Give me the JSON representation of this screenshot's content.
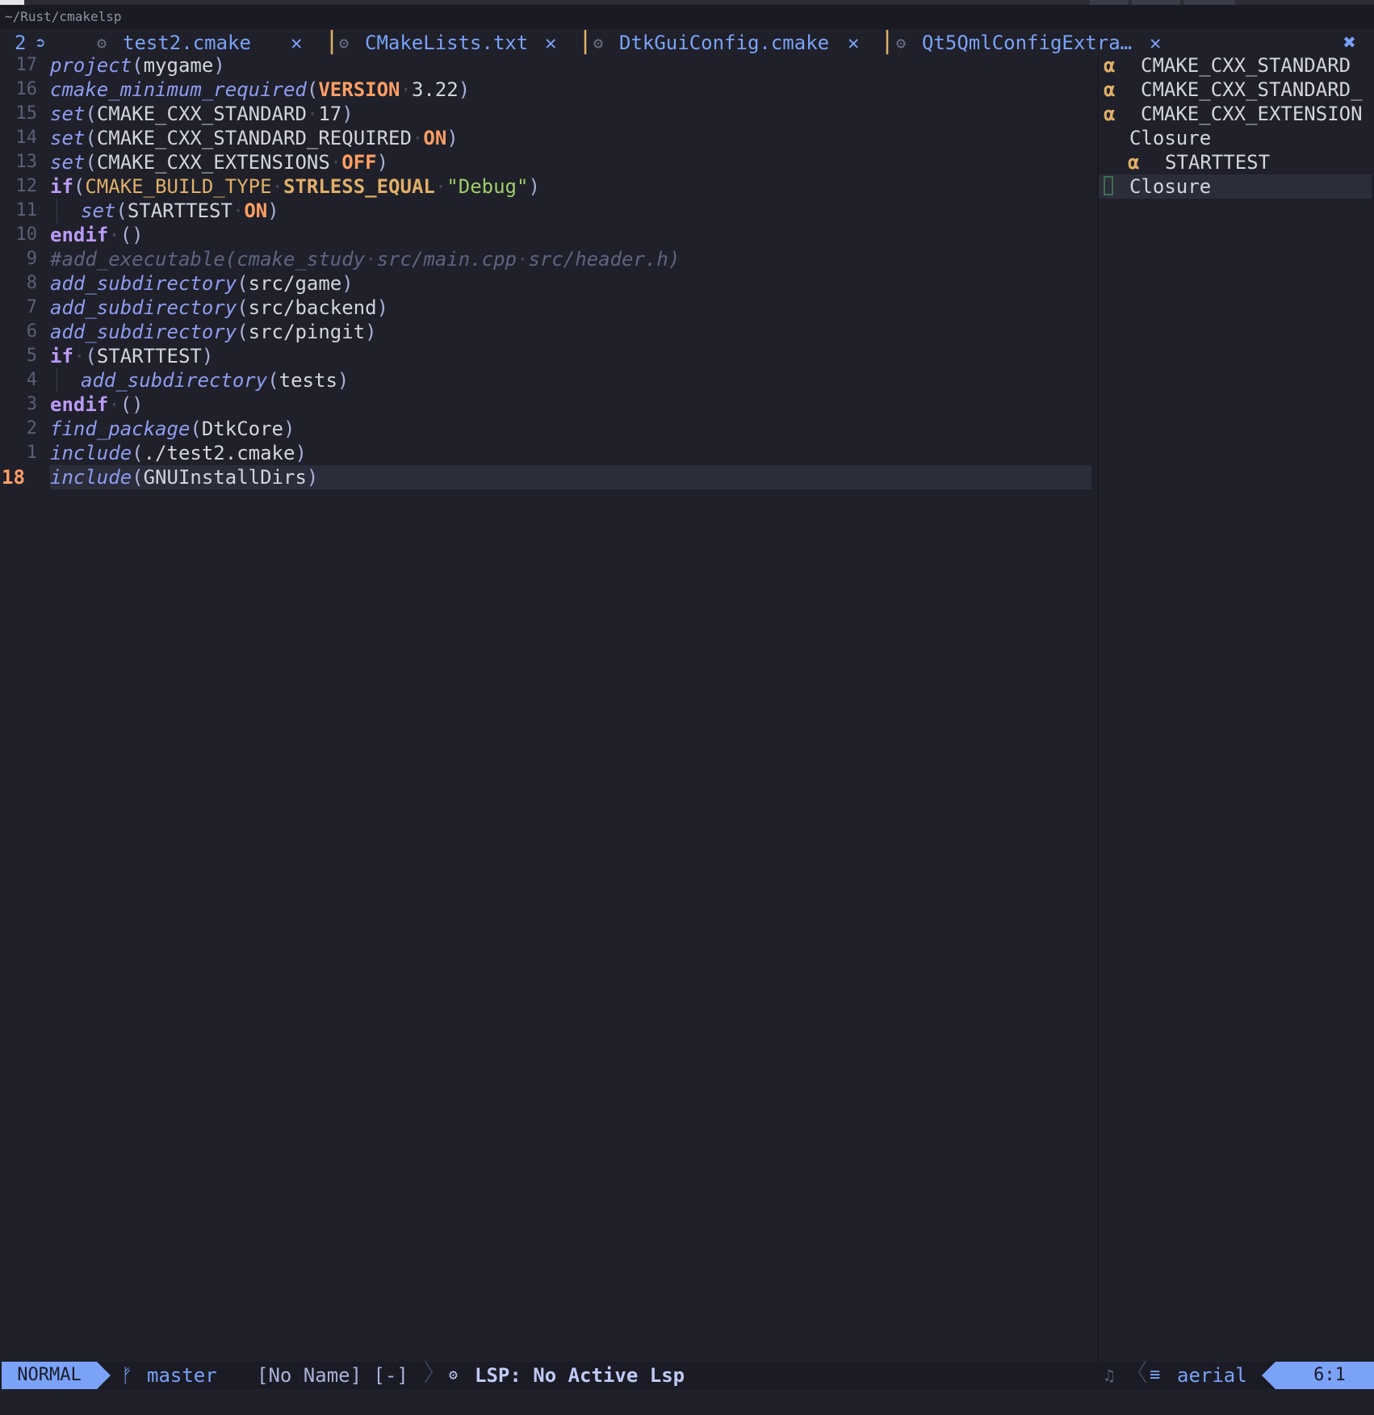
{
  "path": "~/Rust/cmakelsp",
  "tabline": {
    "buffer_count": "2",
    "back_icon": "back-arrow-icon",
    "tabs": [
      {
        "title": "test2.cmake",
        "icon": "gear-icon"
      },
      {
        "title": "CMakeLists.txt",
        "icon": "gear-icon"
      },
      {
        "title": "DtkGuiConfig.cmake",
        "icon": "gear-icon"
      },
      {
        "title": "Qt5QmlConfigExtra…",
        "icon": "gear-icon"
      }
    ]
  },
  "editor": {
    "lines": [
      {
        "num": "17",
        "tokens": [
          [
            "fn",
            "project"
          ],
          [
            "pn",
            "("
          ],
          [
            "tx",
            "mygame"
          ],
          [
            "pn",
            ")"
          ]
        ]
      },
      {
        "num": "16",
        "tokens": [
          [
            "fn",
            "cmake_minimum_required"
          ],
          [
            "pn",
            "("
          ],
          [
            "or",
            "VERSION"
          ],
          [
            "dot",
            "·"
          ],
          [
            "tx",
            "3.22"
          ],
          [
            "pn",
            ")"
          ]
        ]
      },
      {
        "num": "15",
        "tokens": [
          [
            "fn",
            "set"
          ],
          [
            "pn",
            "("
          ],
          [
            "tx",
            "CMAKE_CXX_STANDARD"
          ],
          [
            "dot",
            "·"
          ],
          [
            "tx",
            "17"
          ],
          [
            "pn",
            ")"
          ]
        ]
      },
      {
        "num": "14",
        "tokens": [
          [
            "fn",
            "set"
          ],
          [
            "pn",
            "("
          ],
          [
            "tx",
            "CMAKE_CXX_STANDARD_REQUIRED"
          ],
          [
            "dot",
            "·"
          ],
          [
            "or",
            "ON"
          ],
          [
            "pn",
            ")"
          ]
        ]
      },
      {
        "num": "13",
        "tokens": [
          [
            "fn",
            "set"
          ],
          [
            "pn",
            "("
          ],
          [
            "tx",
            "CMAKE_CXX_EXTENSIONS"
          ],
          [
            "dot",
            "·"
          ],
          [
            "or",
            "OFF"
          ],
          [
            "pn",
            ")"
          ]
        ]
      },
      {
        "num": "12",
        "tokens": [
          [
            "kw",
            "if"
          ],
          [
            "pn",
            "("
          ],
          [
            "yn",
            "CMAKE_BUILD_TYPE"
          ],
          [
            "dot",
            "·"
          ],
          [
            "yl",
            "STRLESS_EQUAL"
          ],
          [
            "dot",
            "·"
          ],
          [
            "str",
            "\"Debug\""
          ],
          [
            "pn",
            ")"
          ]
        ]
      },
      {
        "num": "11",
        "indent": true,
        "tokens": [
          [
            "fn",
            "set"
          ],
          [
            "pn",
            "("
          ],
          [
            "tx",
            "STARTTEST"
          ],
          [
            "dot",
            "·"
          ],
          [
            "or",
            "ON"
          ],
          [
            "pn",
            ")"
          ]
        ]
      },
      {
        "num": "10",
        "tokens": [
          [
            "kw",
            "endif"
          ],
          [
            "dot",
            "·"
          ],
          [
            "pn",
            "()"
          ]
        ]
      },
      {
        "num": "9",
        "tokens": [
          [
            "cm",
            "#add_executable(cmake_study"
          ],
          [
            "dot",
            "·"
          ],
          [
            "cm",
            "src/main.cpp"
          ],
          [
            "dot",
            "·"
          ],
          [
            "cm",
            "src/header.h)"
          ]
        ]
      },
      {
        "num": "8",
        "tokens": [
          [
            "fn",
            "add_subdirectory"
          ],
          [
            "pn",
            "("
          ],
          [
            "tx",
            "src/game"
          ],
          [
            "pn",
            ")"
          ]
        ]
      },
      {
        "num": "7",
        "tokens": [
          [
            "fn",
            "add_subdirectory"
          ],
          [
            "pn",
            "("
          ],
          [
            "tx",
            "src/backend"
          ],
          [
            "pn",
            ")"
          ]
        ]
      },
      {
        "num": "6",
        "tokens": [
          [
            "fn",
            "add_subdirectory"
          ],
          [
            "pn",
            "("
          ],
          [
            "tx",
            "src/pingit"
          ],
          [
            "pn",
            ")"
          ]
        ]
      },
      {
        "num": "5",
        "tokens": [
          [
            "kw",
            "if"
          ],
          [
            "dot",
            "·"
          ],
          [
            "pn",
            "("
          ],
          [
            "tx",
            "STARTTEST"
          ],
          [
            "pn",
            ")"
          ]
        ]
      },
      {
        "num": "4",
        "indent": true,
        "tokens": [
          [
            "fn",
            "add_subdirectory"
          ],
          [
            "pn",
            "("
          ],
          [
            "tx",
            "tests"
          ],
          [
            "pn",
            ")"
          ]
        ]
      },
      {
        "num": "3",
        "tokens": [
          [
            "kw",
            "endif"
          ],
          [
            "dot",
            "·"
          ],
          [
            "pn",
            "()"
          ]
        ]
      },
      {
        "num": "2",
        "tokens": [
          [
            "fn",
            "find_package"
          ],
          [
            "pn",
            "("
          ],
          [
            "tx",
            "DtkCore"
          ],
          [
            "pn",
            ")"
          ]
        ]
      },
      {
        "num": "1",
        "tokens": [
          [
            "fn",
            "include"
          ],
          [
            "pn",
            "("
          ],
          [
            "tx",
            "./test2.cmake"
          ],
          [
            "pn",
            ")"
          ]
        ]
      },
      {
        "num": "18",
        "current": true,
        "tokens": [
          [
            "fn",
            "include"
          ],
          [
            "pn",
            "("
          ],
          [
            "tx",
            "GNUInstallDirs"
          ],
          [
            "pn",
            ")"
          ]
        ]
      }
    ]
  },
  "outline": {
    "items": [
      {
        "icon": "α",
        "label": "CMAKE_CXX_STANDARD",
        "level": 0
      },
      {
        "icon": "α",
        "label": "CMAKE_CXX_STANDARD_",
        "level": 0
      },
      {
        "icon": "α",
        "label": "CMAKE_CXX_EXTENSION",
        "level": 0
      },
      {
        "icon": "",
        "label": "Closure",
        "level": 0
      },
      {
        "icon": "α",
        "label": "STARTTEST",
        "level": 1
      },
      {
        "icon": "",
        "label": "Closure",
        "level": 0,
        "selected": true
      }
    ]
  },
  "statusline": {
    "mode": "NORMAL",
    "branch": "master",
    "filename": "[No Name] [-]",
    "lsp": "LSP: No Active Lsp",
    "aerial": "aerial",
    "position": "6:1"
  },
  "colors": {
    "background": "#1f2029",
    "accent": "#7aa2f7",
    "keyword": "#bb9af7",
    "constant": "#ff9e64",
    "string": "#9ece6a",
    "type": "#e0af68"
  }
}
